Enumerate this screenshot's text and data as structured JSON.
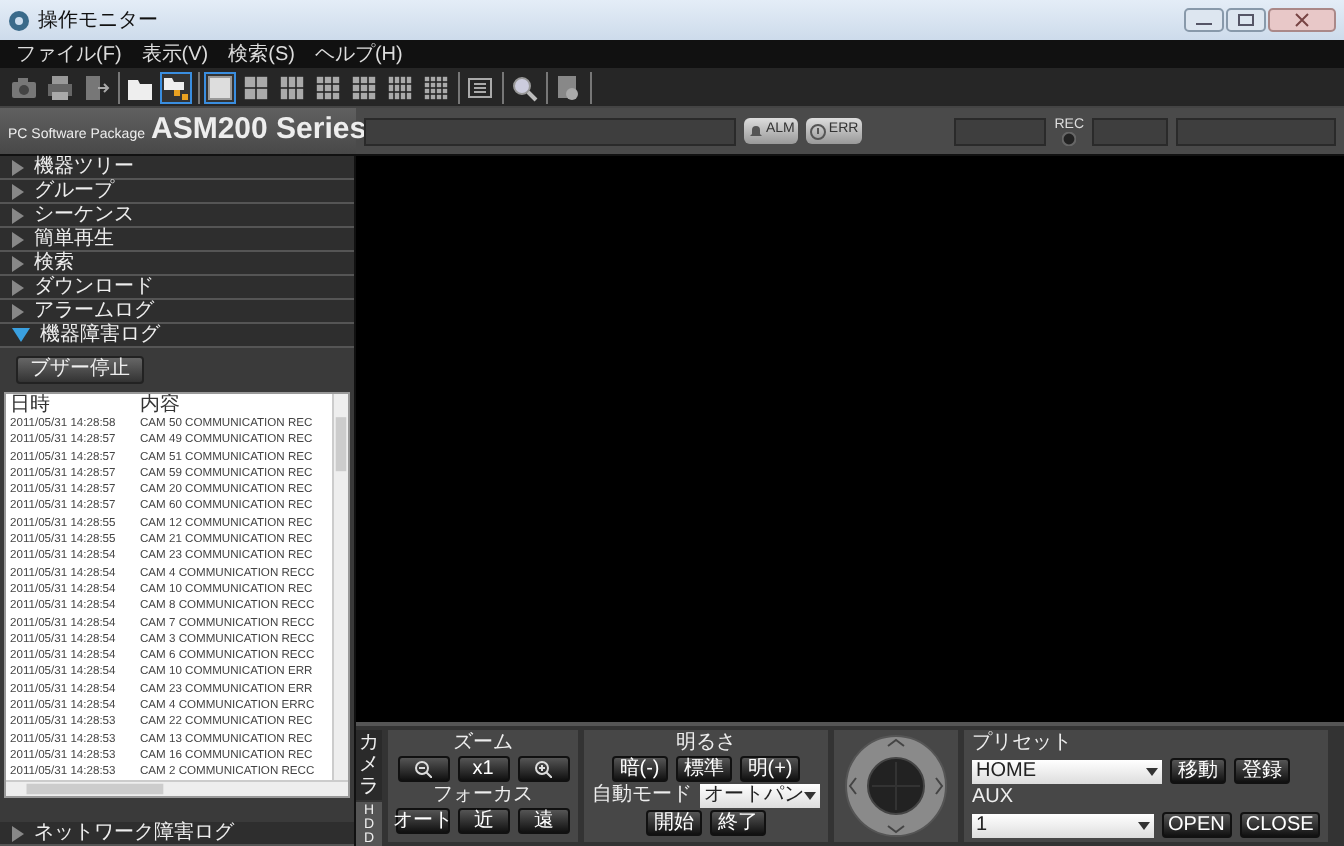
{
  "window": {
    "title": "操作モニター"
  },
  "menu": [
    "ファイル(F)",
    "表示(V)",
    "検索(S)",
    "ヘルプ(H)"
  ],
  "toolbar": [
    {
      "buttons": [
        {
          "kind": "camera",
          "selected": false
        },
        {
          "kind": "printer",
          "selected": false
        },
        {
          "kind": "exit",
          "selected": false
        }
      ]
    },
    {
      "buttons": [
        {
          "kind": "folder",
          "selected": false
        },
        {
          "kind": "folder-tree",
          "selected": true
        }
      ]
    },
    {
      "buttons": [
        {
          "kind": "layout-1",
          "selected": true
        },
        {
          "kind": "layout-4",
          "selected": false
        },
        {
          "kind": "layout-6",
          "selected": false
        },
        {
          "kind": "layout-8",
          "selected": false
        },
        {
          "kind": "layout-9",
          "selected": false
        },
        {
          "kind": "layout-12",
          "selected": false
        },
        {
          "kind": "layout-16",
          "selected": false
        }
      ]
    },
    {
      "buttons": [
        {
          "kind": "sequence",
          "selected": false
        }
      ]
    },
    {
      "buttons": [
        {
          "kind": "search",
          "selected": false
        }
      ]
    },
    {
      "buttons": [
        {
          "kind": "document",
          "selected": false
        }
      ]
    }
  ],
  "brand": {
    "caption": "PC Software Package",
    "product": "ASM200 Series"
  },
  "indicators": [
    {
      "label": "ALM",
      "kind": "alarm"
    },
    {
      "label": "ERR",
      "kind": "error"
    }
  ],
  "rec_label": "REC",
  "sidebar": {
    "items": [
      {
        "label": "機器ツリー",
        "expanded": false
      },
      {
        "label": "グループ",
        "expanded": false
      },
      {
        "label": "シーケンス",
        "expanded": false
      },
      {
        "label": "簡単再生",
        "expanded": false
      },
      {
        "label": "検索",
        "expanded": false
      },
      {
        "label": "ダウンロード",
        "expanded": false
      },
      {
        "label": "アラームログ",
        "expanded": false
      },
      {
        "label": "機器障害ログ",
        "expanded": true
      }
    ],
    "buzzer_button": "ブザー停止",
    "log": {
      "columns": [
        "日時",
        "内容"
      ],
      "rows": [
        [
          "2011/05/31 14:28:58",
          "CAM 50 COMMUNICATION REC"
        ],
        [
          "2011/05/31 14:28:57",
          "CAM 49 COMMUNICATION REC"
        ],
        [
          "2011/05/31 14:28:57",
          "CAM 51 COMMUNICATION REC"
        ],
        [
          "2011/05/31 14:28:57",
          "CAM 59 COMMUNICATION REC"
        ],
        [
          "2011/05/31 14:28:57",
          "CAM 20 COMMUNICATION REC"
        ],
        [
          "2011/05/31 14:28:57",
          "CAM 60 COMMUNICATION REC"
        ],
        [
          "2011/05/31 14:28:55",
          "CAM 12 COMMUNICATION REC"
        ],
        [
          "2011/05/31 14:28:55",
          "CAM 21 COMMUNICATION REC"
        ],
        [
          "2011/05/31 14:28:54",
          "CAM 23 COMMUNICATION REC"
        ],
        [
          "2011/05/31 14:28:54",
          "CAM 4 COMMUNICATION RECC"
        ],
        [
          "2011/05/31 14:28:54",
          "CAM 10 COMMUNICATION REC"
        ],
        [
          "2011/05/31 14:28:54",
          "CAM 8 COMMUNICATION RECC"
        ],
        [
          "2011/05/31 14:28:54",
          "CAM 7 COMMUNICATION RECC"
        ],
        [
          "2011/05/31 14:28:54",
          "CAM 3 COMMUNICATION RECC"
        ],
        [
          "2011/05/31 14:28:54",
          "CAM 6 COMMUNICATION RECC"
        ],
        [
          "2011/05/31 14:28:54",
          "CAM 10 COMMUNICATION ERR"
        ],
        [
          "2011/05/31 14:28:54",
          "CAM 23 COMMUNICATION ERR"
        ],
        [
          "2011/05/31 14:28:54",
          "CAM 4 COMMUNICATION ERRC"
        ],
        [
          "2011/05/31 14:28:53",
          "CAM 22 COMMUNICATION REC"
        ],
        [
          "2011/05/31 14:28:53",
          "CAM 13 COMMUNICATION REC"
        ],
        [
          "2011/05/31 14:28:53",
          "CAM 16 COMMUNICATION REC"
        ],
        [
          "2011/05/31 14:28:53",
          "CAM 2 COMMUNICATION RECC"
        ]
      ]
    },
    "bottom_item": {
      "label": "ネットワーク障害ログ",
      "expanded": false
    }
  },
  "controls": {
    "tabs": [
      {
        "label": "カメラ",
        "selected": true
      },
      {
        "label": "HDD",
        "selected": false
      }
    ],
    "zoom": {
      "label": "ズーム",
      "buttons": [
        {
          "kind": "zoom-out"
        },
        {
          "kind": "text",
          "label": "x1"
        },
        {
          "kind": "zoom-in"
        }
      ]
    },
    "focus": {
      "label": "フォーカス",
      "buttons": [
        "オート",
        "近",
        "遠"
      ]
    },
    "brightness": {
      "label": "明るさ",
      "buttons": [
        "暗(-)",
        "標準",
        "明(+)"
      ]
    },
    "auto_mode": {
      "label": "自動モード",
      "value": "オートパン",
      "buttons": [
        "開始",
        "終了"
      ]
    },
    "preset": {
      "label": "プリセット",
      "value": "HOME",
      "buttons": [
        "移動",
        "登録"
      ]
    },
    "aux": {
      "label": "AUX",
      "value": "1",
      "buttons": [
        "OPEN",
        "CLOSE"
      ]
    }
  }
}
